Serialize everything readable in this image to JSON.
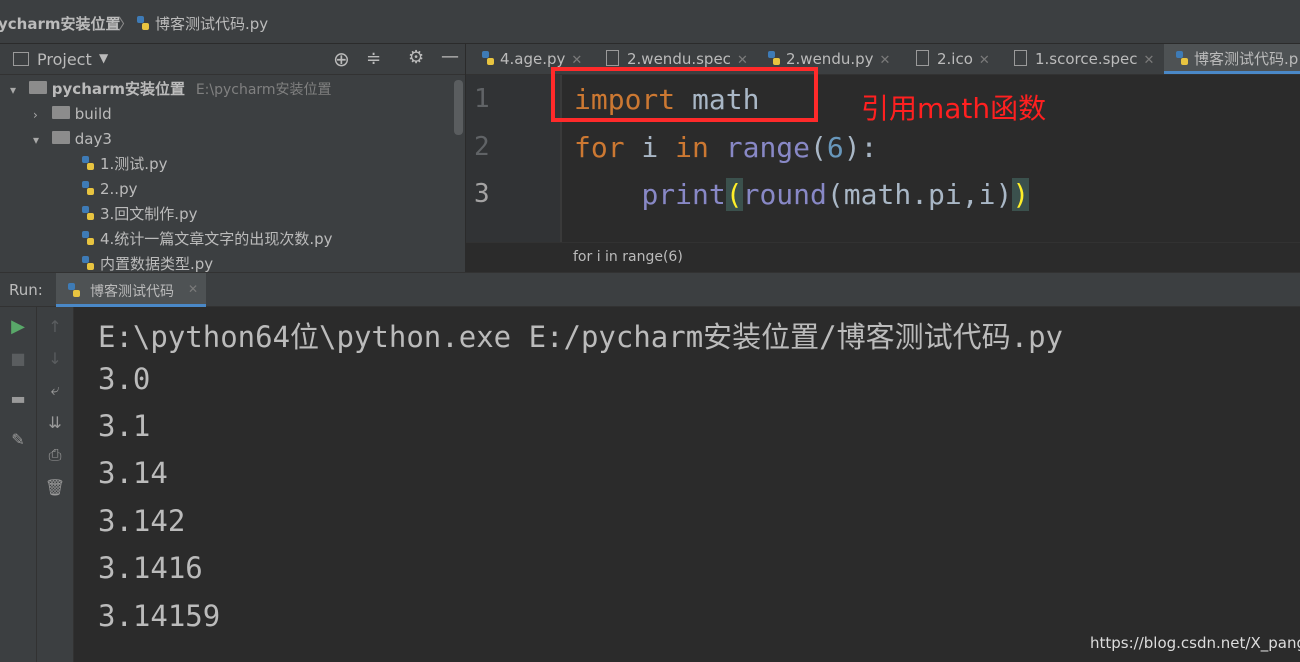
{
  "breadcrumb": {
    "project": "ycharm安装位置",
    "separator": "〉",
    "file": "博客测试代码.py"
  },
  "project_panel": {
    "title": "Project",
    "tree": [
      {
        "label": "pycharm安装位置",
        "path": "E:\\pycharm安装位置",
        "type": "root"
      },
      {
        "label": "build",
        "type": "folder"
      },
      {
        "label": "day3",
        "type": "folder"
      },
      {
        "label": "1.测试.py",
        "type": "file"
      },
      {
        "label": "2..py",
        "type": "file"
      },
      {
        "label": "3.回文制作.py",
        "type": "file"
      },
      {
        "label": "4.统计一篇文章文字的出现次数.py",
        "type": "file"
      },
      {
        "label": "内置数据类型.py",
        "type": "file"
      }
    ]
  },
  "editor": {
    "tabs": [
      {
        "label": "4.age.py"
      },
      {
        "label": "2.wendu.spec"
      },
      {
        "label": "2.wendu.py"
      },
      {
        "label": "2.ico"
      },
      {
        "label": "1.scorce.spec"
      },
      {
        "label": "博客测试代码.p",
        "active": true
      }
    ],
    "line_numbers": [
      "1",
      "2",
      "3"
    ],
    "code": {
      "l1_kw": "import",
      "l1_rest": " math",
      "l2_kw1": "for",
      "l2_var": " i ",
      "l2_kw2": "in",
      "l2_sp": " ",
      "l2_fn": "range",
      "l2_open": "(",
      "l2_num": "6",
      "l2_close": "):",
      "l3_indent": "    ",
      "l3_fn": "print",
      "l3_p1": "(",
      "l3_round": "round",
      "l3_mid": "(math.pi,i)",
      "l3_p2": ")"
    },
    "annotation": "引用math函数",
    "breadcrumb": "for i in range(6)",
    "colors": {
      "annotation": "#ff2020",
      "highlight_box": "#ff2a2a"
    }
  },
  "run": {
    "label": "Run:",
    "tab": "博客测试代码",
    "output": [
      "E:\\python64位\\python.exe E:/pycharm安装位置/博客测试代码.py",
      "3.0",
      "3.1",
      "3.14",
      "3.142",
      "3.1416",
      "3.14159"
    ]
  },
  "watermark": "https://blog.csdn.net/X_pang"
}
